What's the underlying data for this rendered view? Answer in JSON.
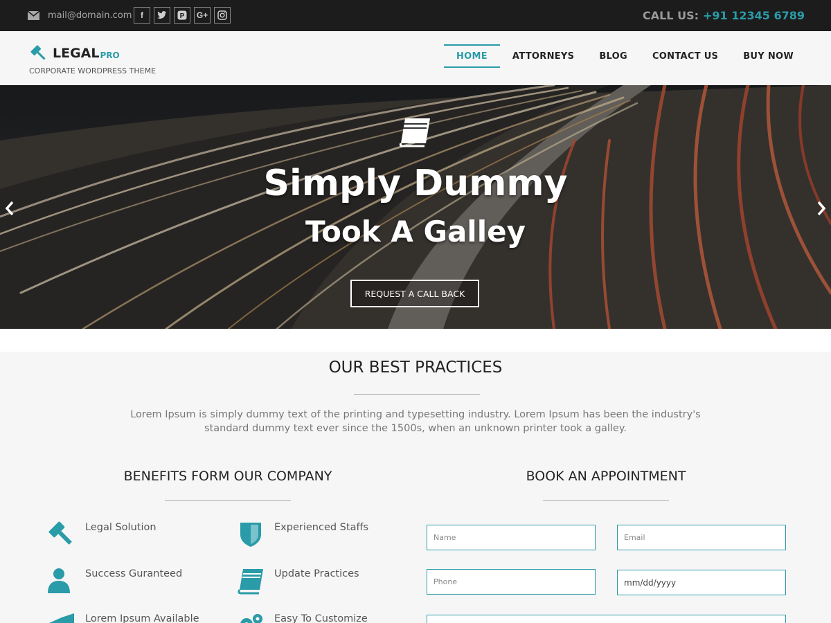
{
  "topbar": {
    "email": "mail@domain.com",
    "socials": [
      "f",
      "t",
      "p",
      "G+",
      "ig"
    ],
    "call_label": "CALL US:",
    "call_number": "+91 12345 6789"
  },
  "header": {
    "logo_main": "LEGAL",
    "logo_sub": "PRO",
    "tagline": "CORPORATE WORDPRESS THEME",
    "nav": [
      "HOME",
      "ATTORNEYS",
      "BLOG",
      "CONTACT US",
      "BUY NOW"
    ]
  },
  "hero": {
    "title": "Simply Dummy",
    "subtitle": "Took A Galley",
    "button": "REQUEST A CALL BACK"
  },
  "practices": {
    "title": "OUR BEST PRACTICES",
    "description": "Lorem Ipsum is simply dummy text of the printing and typesetting industry. Lorem Ipsum has been the industry's standard dummy text ever since the 1500s, when an unknown printer took a galley."
  },
  "benefits": {
    "title": "BENEFITS FORM OUR COMPANY",
    "items": [
      {
        "label": "Legal Solution",
        "icon": "gavel-icon"
      },
      {
        "label": "Experienced Staffs",
        "icon": "shield-icon"
      },
      {
        "label": "Success Guranteed",
        "icon": "user-icon"
      },
      {
        "label": "Update Practices",
        "icon": "book-icon"
      },
      {
        "label": "Lorem Ipsum Available",
        "icon": "chart-icon"
      },
      {
        "label": "Easy To Customize",
        "icon": "gears-icon"
      }
    ]
  },
  "appointment": {
    "title": "BOOK AN APPOINTMENT",
    "name_placeholder": "Name",
    "email_placeholder": "Email",
    "phone_placeholder": "Phone",
    "date_placeholder": "mm/dd/yyyy"
  },
  "colors": {
    "accent": "#2a9ba8",
    "topbar": "#1c1c1c"
  }
}
